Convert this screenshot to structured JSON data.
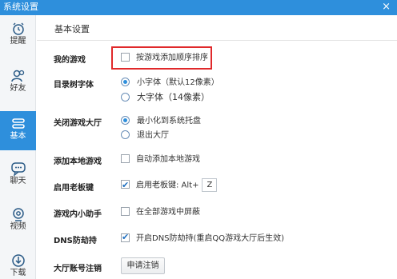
{
  "window": {
    "title": "系统设置",
    "close_glyph": "×"
  },
  "sidebar": {
    "items": [
      {
        "label": "提醒",
        "icon": "alarm-clock-icon"
      },
      {
        "label": "好友",
        "icon": "friends-icon"
      },
      {
        "label": "基本",
        "icon": "settings-list-icon",
        "active": true
      },
      {
        "label": "聊天",
        "icon": "chat-bubble-icon"
      },
      {
        "label": "视频",
        "icon": "video-camera-icon"
      },
      {
        "label": "下载",
        "icon": "download-icon"
      }
    ]
  },
  "header": {
    "title": "基本设置"
  },
  "settings": {
    "my_games": {
      "label": "我的游戏",
      "option": "按游戏添加顺序排序",
      "checked": false
    },
    "tree_font": {
      "label": "目录树字体",
      "options": [
        "小字体（默认12像素）",
        "大字体（14像素）"
      ],
      "selected": 0
    },
    "close_hall": {
      "label": "关闭游戏大厅",
      "options": [
        "最小化到系统托盘",
        "退出大厅"
      ],
      "selected": 0
    },
    "add_local": {
      "label": "添加本地游戏",
      "option": "自动添加本地游戏",
      "checked": false
    },
    "boss_key": {
      "label": "启用老板键",
      "option": "启用老板键: Alt+",
      "key": "Z",
      "checked": true
    },
    "in_game_helper": {
      "label": "游戏内小助手",
      "option": "在全部游戏中屏蔽",
      "checked": false
    },
    "dns": {
      "label": "DNS防劫持",
      "option": "开启DNS防劫持(重启QQ游戏大厅后生效)",
      "checked": true
    },
    "account_cancel": {
      "label": "大厅账号注销",
      "button": "申请注销"
    }
  },
  "colors": {
    "titlebar": "#2e8fdc",
    "active_nav": "#2e8fdc",
    "highlight_box": "#e0292b"
  }
}
